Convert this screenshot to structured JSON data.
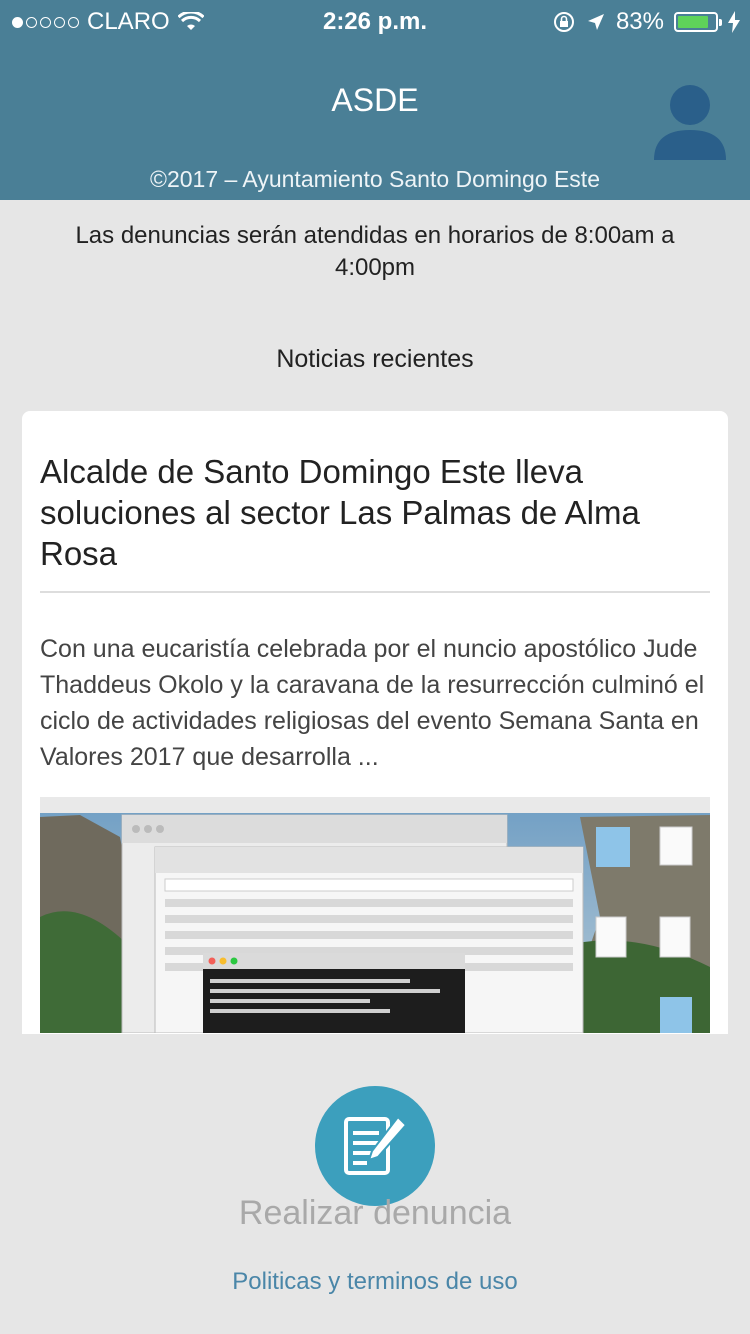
{
  "status_bar": {
    "carrier": "CLARO",
    "time": "2:26 p.m.",
    "battery": "83%",
    "battery_level": 0.83
  },
  "header": {
    "title": "ASDE",
    "copyright": "©2017 – Ayuntamiento Santo Domingo Este",
    "avatar_icon": "user-icon"
  },
  "notice": "Las denuncias serán atendidas en horarios de 8:00am a 4:00pm",
  "news_section_title": "Noticias recientes",
  "article": {
    "title": "Alcalde de Santo Domingo Este lleva soluciones al sector Las Palmas de Alma Rosa",
    "summary": "Con una eucaristía celebrada por el nuncio apostólico Jude Thaddeus Okolo y la caravana de la resurrección culminó el ciclo de actividades religiosas del evento Semana Santa en Valores 2017 que desarrolla ..."
  },
  "action": {
    "icon": "edit-document-icon",
    "label": "Realizar denuncia"
  },
  "footer_link": "Politicas y terminos de uso",
  "colors": {
    "header_bg": "#4a7f96",
    "accent": "#3c9fbd",
    "link": "#4a86a8"
  }
}
